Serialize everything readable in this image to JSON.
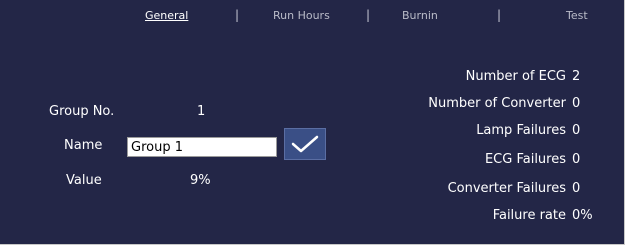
{
  "tabs": [
    {
      "label": "General",
      "active": true
    },
    {
      "label": "Run Hours",
      "active": false
    },
    {
      "label": "Burnin",
      "active": false
    },
    {
      "label": "Test",
      "active": false
    }
  ],
  "tab_separator": "|",
  "group": {
    "group_no_label": "Group No.",
    "group_no_value": "1",
    "name_label": "Name",
    "name_value": "Group 1",
    "value_label": "Value",
    "value_value": "9%",
    "apply_icon": "checkmark-icon"
  },
  "stats": [
    {
      "label": "Number of ECG",
      "value": "2"
    },
    {
      "label": "Number of Converter",
      "value": "0"
    },
    {
      "label": "Lamp Failures",
      "value": "0"
    },
    {
      "label": "ECG Failures",
      "value": "0"
    },
    {
      "label": "Converter Failures",
      "value": "0"
    },
    {
      "label": "Failure rate",
      "value": "0%"
    }
  ],
  "colors": {
    "panel_bg": "#232647",
    "text": "#ffffff",
    "tab_inactive": "#b9bbc8",
    "button_bg": "#3a4f86"
  }
}
